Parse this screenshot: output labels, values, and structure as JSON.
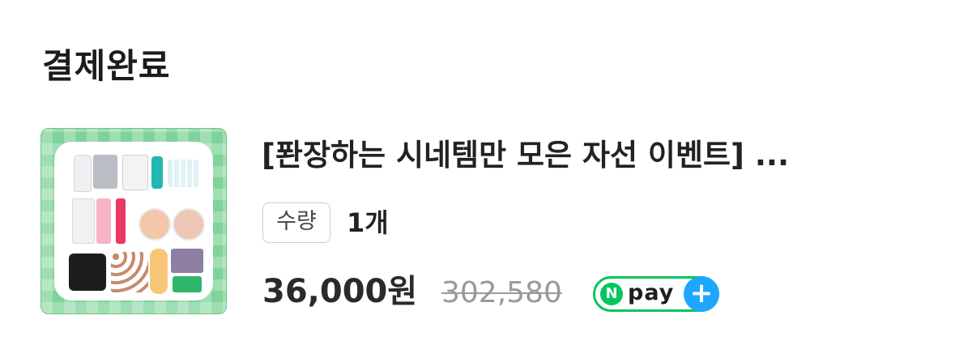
{
  "header": {
    "title": "결제완료"
  },
  "order_item": {
    "product_name": "[퐌장하는 시네템만 모은 자선 이벤트] ...",
    "quantity_label": "수량",
    "quantity_value": "1개",
    "price": "36,000원",
    "original_price": "302,580",
    "payment_badge": {
      "n_text": "N",
      "pay_text": "pay",
      "plus_text": "+",
      "colors": {
        "green": "#03c75a",
        "blue": "#1ea7ff"
      }
    }
  },
  "thumbnail": {
    "background_color": "#7fd39a"
  }
}
